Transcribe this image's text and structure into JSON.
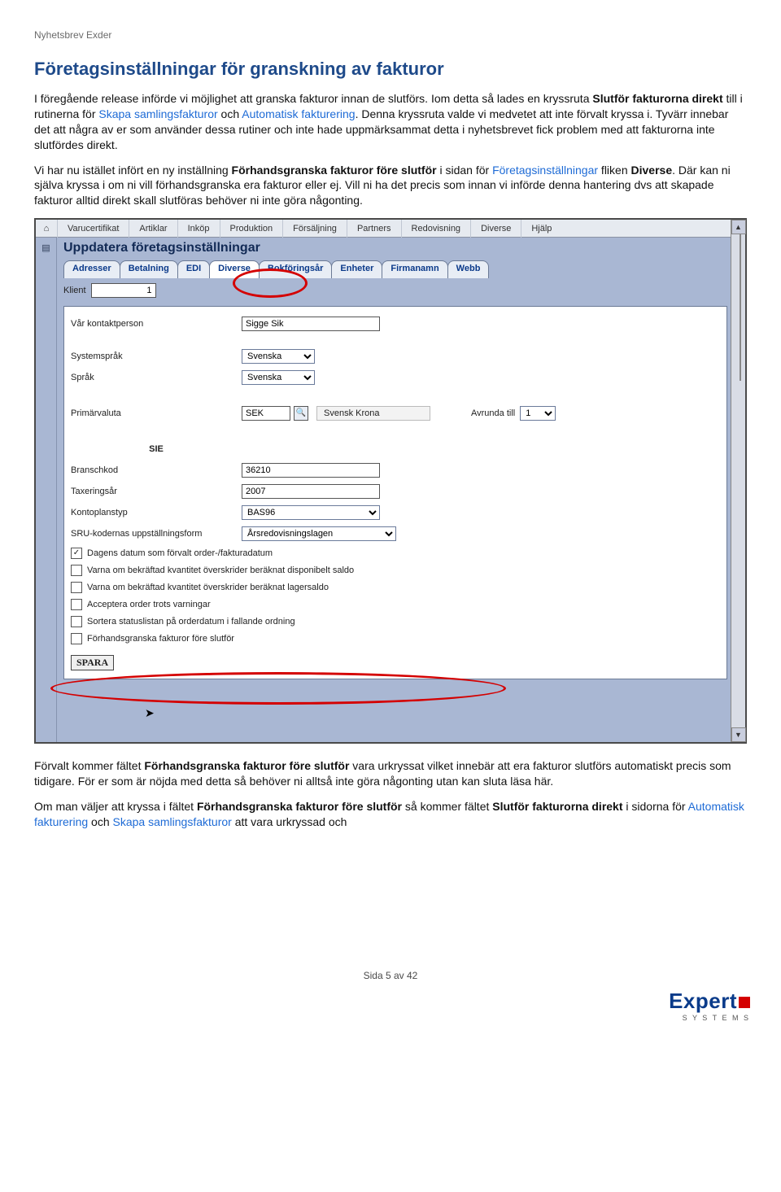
{
  "doc": {
    "header": "Nyhetsbrev Exder",
    "section_title": "Företagsinställningar för granskning av fakturor",
    "p1_a": "I föregående release införde vi möjlighet att granska fakturor innan de slutförs. Iom detta så lades en kryssruta ",
    "p1_b": "Slutför fakturorna direkt",
    "p1_c": " till i rutinerna för ",
    "p1_link1": "Skapa samlingsfakturor",
    "p1_d": " och ",
    "p1_link2": "Automatisk fakturering",
    "p1_e": ". Denna kryssruta valde vi medvetet att inte förvalt kryssa i. Tyvärr innebar det att några av er som använder dessa rutiner och inte hade uppmärksammat detta i nyhetsbrevet fick problem med att fakturorna inte slutfördes direkt.",
    "p2_a": "Vi har nu istället infört en ny inställning ",
    "p2_b": "Förhandsgranska fakturor före slutför",
    "p2_c": " i sidan för ",
    "p2_link1": "Företagsinställningar",
    "p2_d": " fliken ",
    "p2_e": "Diverse",
    "p2_f": ". Där kan ni själva kryssa i om ni vill förhandsgranska era fakturor eller ej. Vill ni ha det precis som innan vi införde denna hantering dvs att skapade fakturor alltid direkt skall slutföras behöver ni inte göra någonting.",
    "p3_a": "Förvalt kommer fältet ",
    "p3_b": "Förhandsgranska fakturor före slutför",
    "p3_c": " vara urkryssat vilket innebär att era fakturor slutförs automatiskt precis som tidigare. För er som är nöjda med detta så behöver ni alltså inte göra någonting utan kan sluta läsa här.",
    "p4_a": "Om man väljer att kryssa i fältet ",
    "p4_b": "Förhandsgranska fakturor före slutför",
    "p4_c": " så kommer fältet ",
    "p4_d": "Slutför fakturorna direkt",
    "p4_e": " i sidorna för ",
    "p4_link1": "Automatisk fakturering",
    "p4_f": " och ",
    "p4_link2": "Skapa samlingsfakturor",
    "p4_g": " att vara urkryssad och",
    "footer": "Sida 5 av 42",
    "logo_brand": "Expert",
    "logo_sub": "S Y S T E M S"
  },
  "app": {
    "menubar": [
      "Varucertifikat",
      "Artiklar",
      "Inköp",
      "Produktion",
      "Försäljning",
      "Partners",
      "Redovisning",
      "Diverse",
      "Hjälp"
    ],
    "title": "Uppdatera företagsinställningar",
    "tabs": [
      "Adresser",
      "Betalning",
      "EDI",
      "Diverse",
      "Bokföringsår",
      "Enheter",
      "Firmanamn",
      "Webb"
    ],
    "klient_label": "Klient",
    "klient_value": "1",
    "field_contact_label": "Vår kontaktperson",
    "field_contact_value": "Sigge Sik",
    "field_syslang_label": "Systemspråk",
    "field_syslang_value": "Svenska",
    "field_lang_label": "Språk",
    "field_lang_value": "Svenska",
    "field_primcur_label": "Primärvaluta",
    "field_primcur_value": "SEK",
    "field_primcur_name": "Svensk Krona",
    "avrunda_label": "Avrunda till",
    "avrunda_value": "1",
    "sie_header": "SIE",
    "field_branschkod_label": "Branschkod",
    "field_branschkod_value": "36210",
    "field_tax_label": "Taxeringsår",
    "field_tax_value": "2007",
    "field_kontoplan_label": "Kontoplanstyp",
    "field_kontoplan_value": "BAS96",
    "field_sru_label": "SRU-kodernas uppställningsform",
    "field_sru_value": "Årsredovisningslagen",
    "check1": "Dagens datum som förvalt order-/fakturadatum",
    "check2": "Varna om bekräftad kvantitet överskrider beräknat disponibelt saldo",
    "check3": "Varna om bekräftad kvantitet överskrider beräknat lagersaldo",
    "check4": "Acceptera order trots varningar",
    "check5": "Sortera statuslistan på orderdatum i fallande ordning",
    "check6": "Förhandsgranska fakturor före slutför",
    "save_button": "SPARA"
  }
}
